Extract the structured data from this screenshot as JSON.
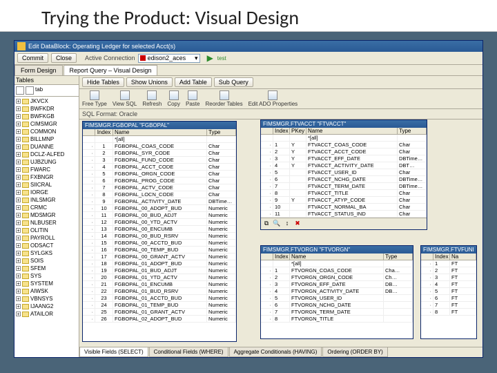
{
  "slide": {
    "title": "Trying the Product: Visual Design"
  },
  "titlebar": "Edit DataBlock: Operating Ledger for selected Acct(s)",
  "mainbar": {
    "commit": "Commit",
    "close": "Close",
    "conn_label": "Active Connection",
    "conn_value": "edison2_aces",
    "test": "test"
  },
  "tabs": {
    "form": "Form Design",
    "report": "Report Query – Visual Design"
  },
  "left": {
    "header": "Tables",
    "tab_label": "tab",
    "items": [
      "JKVCX",
      "BWFKDR",
      "BWFKGB",
      "CIMSMGR",
      "COMMON",
      "BILLMNP",
      "DUANNE",
      "DCLZ-ALFED",
      "UJBZUNG",
      "FWARC",
      "FXBNGR",
      "SIICRAL",
      "IORGE",
      "INLSMGR",
      "CRMC",
      "MDSMGR",
      "NLBUSER",
      "OLITIN",
      "PAYROLL",
      "ODSACT",
      "SYLGKS",
      "SOIS",
      "SFEM",
      "SYS",
      "SYSTEM",
      "AIWSK",
      "VBNSYS",
      "IJAANG2",
      "ATAILOR"
    ]
  },
  "toolbar2": {
    "hide": "Hide Tables",
    "unions": "Show Unions",
    "add": "Add Table",
    "sub": "Sub Query"
  },
  "toolbar3": [
    "Free Type",
    "View SQL",
    "Refresh",
    "Copy",
    "Paste",
    "Reorder Tables",
    "Edit ADO Properties"
  ],
  "sqlfmt": "SQL Format: Oracle",
  "win1": {
    "title": "FIMSMGR.FGBOPAL \"FGBOPAL\"",
    "head": {
      "blank": "",
      "index": "Index",
      "name": "Name",
      "type": "Type"
    },
    "all": "*[all]",
    "rows": [
      {
        "i": "1",
        "n": "FGBOPAL_COAS_CODE",
        "t": "Char"
      },
      {
        "i": "2",
        "n": "FGBOPAL_SYR_CODE",
        "t": "Char"
      },
      {
        "i": "3",
        "n": "FGBOPAL_FUND_CODE",
        "t": "Char"
      },
      {
        "i": "4",
        "n": "FGBOPAL_ACCT_CODE",
        "t": "Char"
      },
      {
        "i": "5",
        "n": "FGBOPAL_ORGN_CODE",
        "t": "Char"
      },
      {
        "i": "6",
        "n": "FGBOPAL_PROG_CODE",
        "t": "Char"
      },
      {
        "i": "7",
        "n": "FGBOPAL_ACTV_CODE",
        "t": "Char"
      },
      {
        "i": "8",
        "n": "FGBOPAL_LOCN_CODE",
        "t": "Char"
      },
      {
        "i": "9",
        "n": "FGBOPAL_ACTIVITY_DATE",
        "t": "DBTime…"
      },
      {
        "i": "10",
        "n": "FGBOPAL_00_ADOPT_BUD",
        "t": "Numeric"
      },
      {
        "i": "11",
        "n": "FGBOPAL_00_BUD_ADJT",
        "t": "Numeric"
      },
      {
        "i": "12",
        "n": "FGBOPAL_00_YTD_ACTV",
        "t": "Numeric"
      },
      {
        "i": "13",
        "n": "FGBOPAL_00_ENCUMB",
        "t": "Numeric"
      },
      {
        "i": "14",
        "n": "FGBOPAL_00_BUD_RSRV",
        "t": "Numeric"
      },
      {
        "i": "15",
        "n": "FGBOPAL_00_ACCTD_BUD",
        "t": "Numeric"
      },
      {
        "i": "16",
        "n": "FGBOPAL_00_TEMP_BUD",
        "t": "Numeric"
      },
      {
        "i": "17",
        "n": "FGBOPAL_00_GRANT_ACTV",
        "t": "Numeric"
      },
      {
        "i": "18",
        "n": "FGBOPAL_01_ADOPT_BUD",
        "t": "Numeric"
      },
      {
        "i": "19",
        "n": "FGBOPAL_01_BUD_ADJT",
        "t": "Numeric"
      },
      {
        "i": "20",
        "n": "FGBOPAL_01_YTD_ACTV",
        "t": "Numeric"
      },
      {
        "i": "21",
        "n": "FGBOPAL_01_ENCUMB",
        "t": "Numeric"
      },
      {
        "i": "22",
        "n": "FGBOPAL_01_BUD_RSRV",
        "t": "Numeric"
      },
      {
        "i": "23",
        "n": "FGBOPAL_01_ACCTD_BUD",
        "t": "Numeric"
      },
      {
        "i": "24",
        "n": "FGBOPAL_01_TEMP_BUD",
        "t": "Numeric"
      },
      {
        "i": "25",
        "n": "FGBOPAL_01_GRANT_ACTV",
        "t": "Numeric"
      },
      {
        "i": "26",
        "n": "FGBOPAL_02_ADOPT_BUD",
        "t": "Numeric"
      }
    ]
  },
  "win2": {
    "title": "FIMSMGR.FTVACCT \"FTVACCT\"",
    "head": {
      "idx": "Index",
      "pkey": "PKey",
      "name": "Name",
      "type": "Type"
    },
    "all": "*[all]",
    "rows": [
      {
        "i": "1",
        "p": "Y",
        "n": "FTVACCT_COAS_CODE",
        "t": "Char"
      },
      {
        "i": "2",
        "p": "Y",
        "n": "FTVACCT_ACCT_CODE",
        "t": "Char"
      },
      {
        "i": "3",
        "p": "Y",
        "n": "FTVACCT_EFF_DATE",
        "t": "DBTime…"
      },
      {
        "i": "4",
        "p": "Y",
        "n": "FTVACCT_ACTIVITY_DATE",
        "t": "DBT…"
      },
      {
        "i": "5",
        "p": "",
        "n": "FTVACCT_USER_ID",
        "t": "Char"
      },
      {
        "i": "6",
        "p": "",
        "n": "FTVACCT_NCHG_DATE",
        "t": "DBTime…"
      },
      {
        "i": "7",
        "p": "",
        "n": "FTVACCT_TERM_DATE",
        "t": "DBTime…"
      },
      {
        "i": "8",
        "p": "",
        "n": "FTVACCT_TITLE",
        "t": "Char"
      },
      {
        "i": "9",
        "p": "Y",
        "n": "FTVACCT_ATYP_CODE",
        "t": "Char"
      },
      {
        "i": "10",
        "p": "",
        "n": "FTVACCT_NORMAL_BA",
        "t": "Char"
      },
      {
        "i": "11",
        "p": "",
        "n": "FTVACCT_STATUS_IND",
        "t": "Char"
      }
    ]
  },
  "win3": {
    "title": "FIMSMGR.FTVORGN \"FTVORGN\"",
    "head": {
      "idx": "Index",
      "name": "Name",
      "type": "Type"
    },
    "all": "*[all]",
    "rows": [
      {
        "i": "1",
        "n": "FTVORGN_COAS_CODE",
        "t": "Cha…"
      },
      {
        "i": "2",
        "n": "FTVORGN_ORGN_CODE",
        "t": "Ch…"
      },
      {
        "i": "3",
        "n": "FTVORGN_EFF_DATE",
        "t": "DB…"
      },
      {
        "i": "4",
        "n": "FTVORGN_ACTIVITY_DATE",
        "t": "DB…"
      },
      {
        "i": "5",
        "n": "FTVORGN_USER_ID",
        "t": ""
      },
      {
        "i": "6",
        "n": "FTVORGN_NCHG_DATE",
        "t": ""
      },
      {
        "i": "7",
        "n": "FTVORGN_TERM_DATE",
        "t": ""
      },
      {
        "i": "8",
        "n": "FTVORGN_TITLE",
        "t": ""
      }
    ]
  },
  "win4": {
    "title": "FIMSMGR.FTVFUNI",
    "head": {
      "idx": "Index",
      "name": "Na"
    },
    "rows": [
      {
        "i": "1",
        "n": "FT"
      },
      {
        "i": "2",
        "n": "FT"
      },
      {
        "i": "3",
        "n": "FT"
      },
      {
        "i": "4",
        "n": "FT"
      },
      {
        "i": "5",
        "n": "FT"
      },
      {
        "i": "6",
        "n": "FT"
      },
      {
        "i": "7",
        "n": "FT"
      },
      {
        "i": "8",
        "n": "FT"
      }
    ]
  },
  "bottom_tabs": {
    "visible": "Visible Fields (SELECT)",
    "cond": "Conditional Fields (WHERE)",
    "agg": "Aggregate Conditionals (HAVING)",
    "order": "Ordering (ORDER BY)"
  }
}
